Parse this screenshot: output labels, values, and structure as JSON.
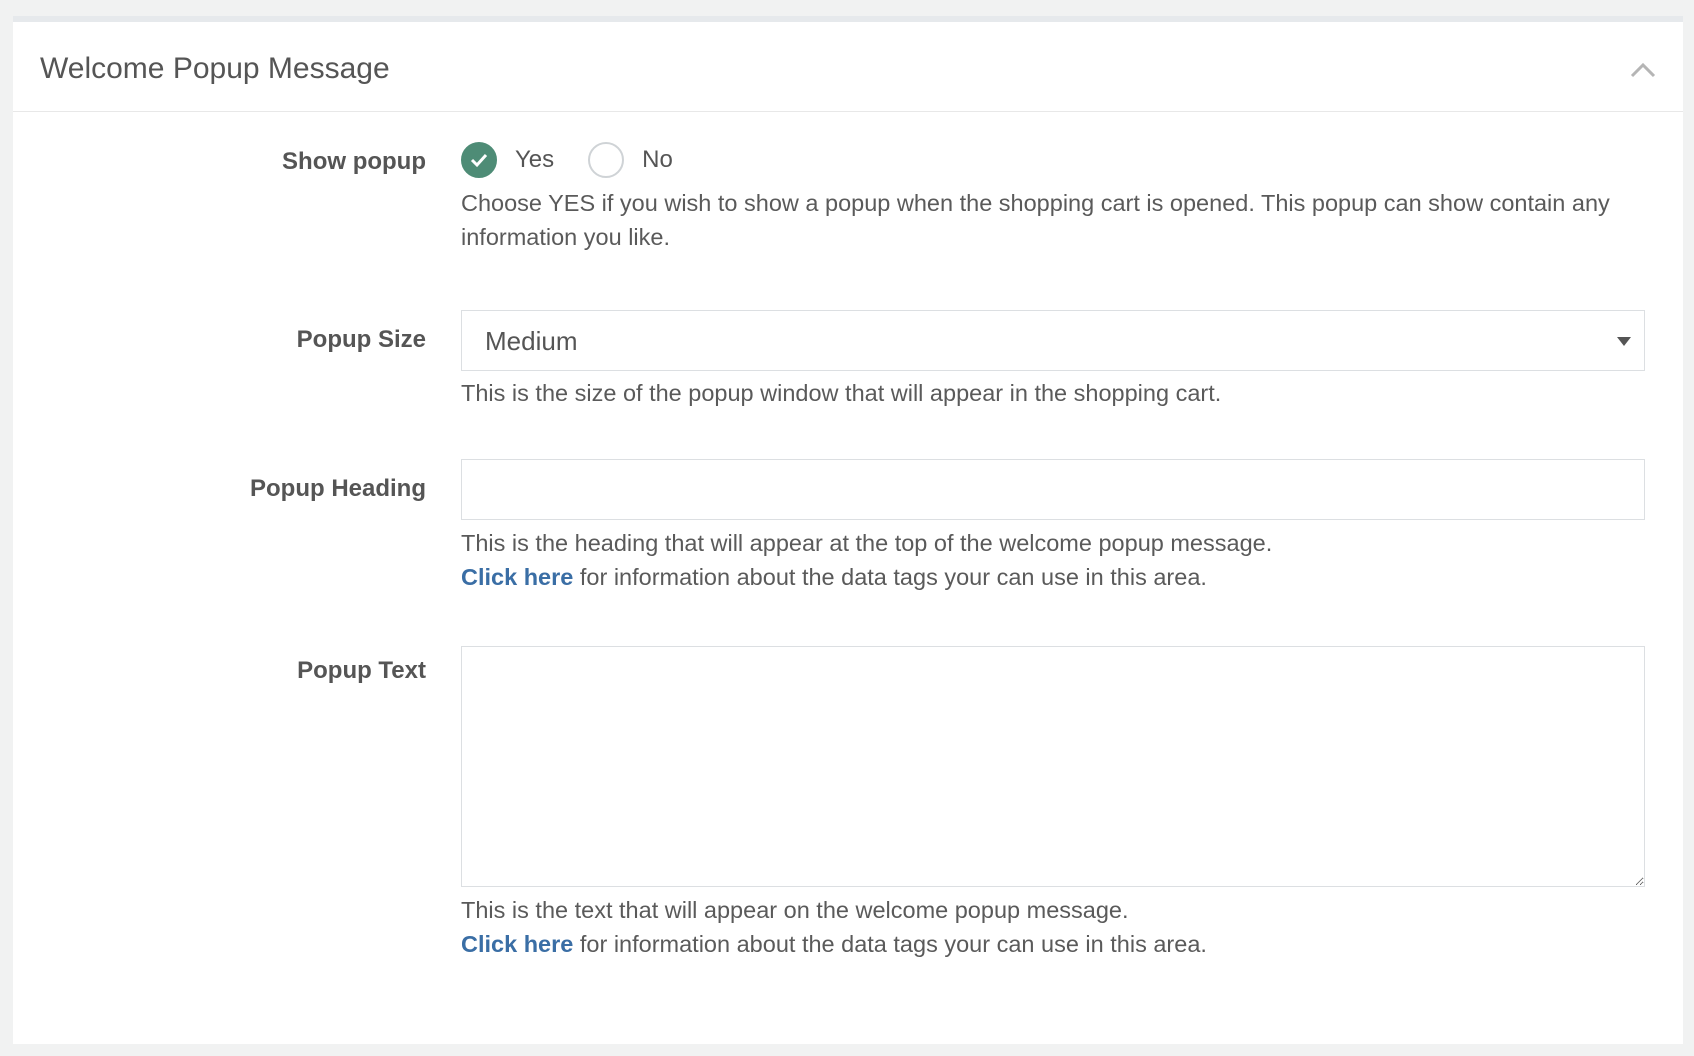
{
  "panel": {
    "title": "Welcome Popup Message",
    "collapse_icon": "chevron-up-icon"
  },
  "show_popup": {
    "label": "Show popup",
    "options": [
      {
        "label": "Yes",
        "checked": true
      },
      {
        "label": "No",
        "checked": false
      }
    ],
    "help": "Choose YES if you wish to show a popup when the shopping cart is opened. This popup can show contain any information you like."
  },
  "popup_size": {
    "label": "Popup Size",
    "selected": "Medium",
    "help": "This is the size of the popup window that will appear in the shopping cart."
  },
  "popup_heading": {
    "label": "Popup Heading",
    "value": "",
    "help": "This is the heading that will appear at the top of the welcome popup message.",
    "link_text": "Click here",
    "link_suffix": " for information about the data tags your can use in this area."
  },
  "popup_text": {
    "label": "Popup Text",
    "value": "",
    "help": "This is the text that will appear on the welcome popup message.",
    "link_text": "Click here",
    "link_suffix": " for information about the data tags your can use in this area."
  },
  "colors": {
    "accent": "#4e8c76",
    "link": "#3a6ea5"
  }
}
